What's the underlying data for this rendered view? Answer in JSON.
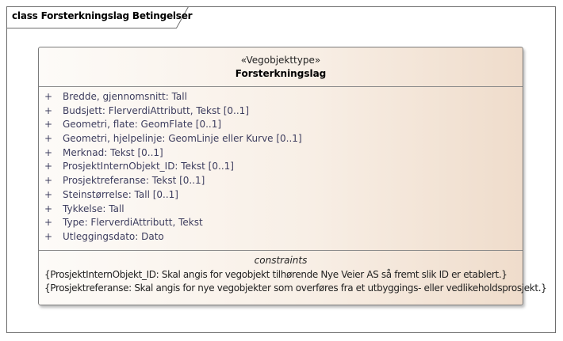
{
  "frame": {
    "title": "class Forsterkningslag Betingelser"
  },
  "class": {
    "stereotype": "«Vegobjekttype»",
    "name": "Forsterkningslag",
    "attributes": [
      {
        "visibility": "+",
        "text": "Bredde, gjennomsnitt: Tall"
      },
      {
        "visibility": "+",
        "text": "Budsjett: FlerverdiAttributt, Tekst [0..1]"
      },
      {
        "visibility": "+",
        "text": "Geometri, flate: GeomFlate [0..1]"
      },
      {
        "visibility": "+",
        "text": "Geometri, hjelpelinje: GeomLinje eller Kurve [0..1]"
      },
      {
        "visibility": "+",
        "text": "Merknad: Tekst [0..1]"
      },
      {
        "visibility": "+",
        "text": "ProsjektInternObjekt_ID: Tekst [0..1]"
      },
      {
        "visibility": "+",
        "text": "Prosjektreferanse: Tekst [0..1]"
      },
      {
        "visibility": "+",
        "text": "Steinstørrelse: Tall [0..1]"
      },
      {
        "visibility": "+",
        "text": "Tykkelse: Tall"
      },
      {
        "visibility": "+",
        "text": "Type: FlerverdiAttributt, Tekst"
      },
      {
        "visibility": "+",
        "text": "Utleggingsdato: Dato"
      }
    ],
    "constraints_title": "constraints",
    "constraints": [
      "{ProsjektInternObjekt_ID: Skal angis for vegobjekt tilhørende Nye Veier AS så fremt slik ID er etablert.}",
      "{Prosjektreferanse: Skal angis for nye vegobjekter som overføres fra et utbyggings- eller vedlikeholdsprosjekt.}"
    ]
  },
  "colors": {
    "border": "#7b7b7b",
    "gradient_start": "#fdfbf8",
    "gradient_end": "#efdccb",
    "attribute_text": "#3d3d5e"
  }
}
